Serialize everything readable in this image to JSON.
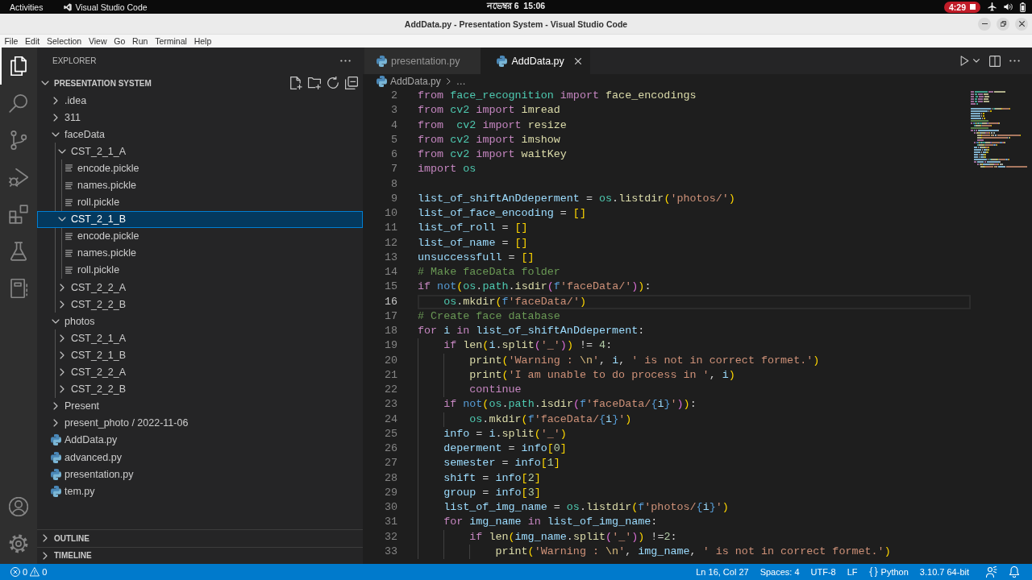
{
  "top_bar": {
    "activities": "Activities",
    "app_name": "Visual Studio Code",
    "clock": "নভেম্বর 6  15:06",
    "recording": "4:29"
  },
  "window": {
    "title": "AddData.py - Presentation System - Visual Studio Code"
  },
  "menu_bar": [
    "File",
    "Edit",
    "Selection",
    "View",
    "Go",
    "Run",
    "Terminal",
    "Help"
  ],
  "activity_bar": {
    "items": [
      {
        "kind": "explorer",
        "selected": true
      },
      {
        "kind": "search",
        "selected": false
      },
      {
        "kind": "scm",
        "selected": false
      },
      {
        "kind": "debug",
        "selected": false
      },
      {
        "kind": "extensions",
        "selected": false
      },
      {
        "kind": "testing",
        "selected": false
      },
      {
        "kind": "notebook",
        "selected": false
      }
    ],
    "bottom_items": [
      {
        "kind": "accounts"
      },
      {
        "kind": "manage"
      }
    ]
  },
  "sidebar": {
    "title": "EXPLORER",
    "workspace": {
      "title": "PRESENTATION SYSTEM",
      "expanded": true
    },
    "tree": [
      {
        "label": ".idea",
        "kind": "folder",
        "expanded": false,
        "selected": false
      },
      {
        "label": "311",
        "kind": "folder",
        "expanded": false,
        "selected": false
      },
      {
        "label": "faceData",
        "kind": "folder",
        "expanded": true,
        "selected": false,
        "children": [
          {
            "label": "CST_2_1_A",
            "kind": "folder",
            "expanded": true,
            "selected": false,
            "children": [
              {
                "label": "encode.pickle",
                "kind": "data",
                "selected": false
              },
              {
                "label": "names.pickle",
                "kind": "data",
                "selected": false
              },
              {
                "label": "roll.pickle",
                "kind": "data",
                "selected": false
              }
            ]
          },
          {
            "label": "CST_2_1_B",
            "kind": "folder",
            "expanded": true,
            "selected": true,
            "children": [
              {
                "label": "encode.pickle",
                "kind": "data",
                "selected": false
              },
              {
                "label": "names.pickle",
                "kind": "data",
                "selected": false
              },
              {
                "label": "roll.pickle",
                "kind": "data",
                "selected": false
              }
            ]
          },
          {
            "label": "CST_2_2_A",
            "kind": "folder",
            "expanded": false,
            "selected": false
          },
          {
            "label": "CST_2_2_B",
            "kind": "folder",
            "expanded": false,
            "selected": false
          }
        ]
      },
      {
        "label": "photos",
        "kind": "folder",
        "expanded": true,
        "selected": false,
        "children": [
          {
            "label": "CST_2_1_A",
            "kind": "folder",
            "expanded": false,
            "selected": false
          },
          {
            "label": "CST_2_1_B",
            "kind": "folder",
            "expanded": false,
            "selected": false
          },
          {
            "label": "CST_2_2_A",
            "kind": "folder",
            "expanded": false,
            "selected": false
          },
          {
            "label": "CST_2_2_B",
            "kind": "folder",
            "expanded": false,
            "selected": false
          }
        ]
      },
      {
        "label": "Present",
        "kind": "folder",
        "expanded": false,
        "selected": false
      },
      {
        "label": "present_photo / 2022-11-06",
        "kind": "folder",
        "expanded": false,
        "selected": false
      },
      {
        "label": "AddData.py",
        "kind": "python",
        "selected": false
      },
      {
        "label": "advanced.py",
        "kind": "python",
        "selected": false
      },
      {
        "label": "presentation.py",
        "kind": "python",
        "selected": false
      },
      {
        "label": "tem.py",
        "kind": "python",
        "selected": false
      }
    ],
    "sections": [
      {
        "title": "OUTLINE",
        "expanded": false
      },
      {
        "title": "TIMELINE",
        "expanded": false
      }
    ]
  },
  "editor": {
    "tabs": [
      {
        "label": "presentation.py",
        "selected": false
      },
      {
        "label": "AddData.py",
        "selected": true
      }
    ],
    "breadcrumb": {
      "file": "AddData.py",
      "trail": "…"
    },
    "lines": [
      {
        "number": "2",
        "current": false,
        "tokens": [
          {
            "text": "from ",
            "kind": "keyword"
          },
          {
            "text": "face_recognition ",
            "kind": "module"
          },
          {
            "text": "import ",
            "kind": "keyword"
          },
          {
            "text": "face_encodings",
            "kind": "function"
          }
        ]
      },
      {
        "number": "3",
        "current": false,
        "tokens": [
          {
            "text": "from ",
            "kind": "keyword"
          },
          {
            "text": "cv2 ",
            "kind": "module"
          },
          {
            "text": "import ",
            "kind": "keyword"
          },
          {
            "text": "imread",
            "kind": "function"
          }
        ]
      },
      {
        "number": "4",
        "current": false,
        "tokens": [
          {
            "text": "from  ",
            "kind": "keyword"
          },
          {
            "text": "cv2 ",
            "kind": "module"
          },
          {
            "text": "import ",
            "kind": "keyword"
          },
          {
            "text": "resize",
            "kind": "function"
          }
        ]
      },
      {
        "number": "5",
        "current": false,
        "tokens": [
          {
            "text": "from ",
            "kind": "keyword"
          },
          {
            "text": "cv2 ",
            "kind": "module"
          },
          {
            "text": "import ",
            "kind": "keyword"
          },
          {
            "text": "imshow",
            "kind": "function"
          }
        ]
      },
      {
        "number": "6",
        "current": false,
        "tokens": [
          {
            "text": "from ",
            "kind": "keyword"
          },
          {
            "text": "cv2 ",
            "kind": "module"
          },
          {
            "text": "import ",
            "kind": "keyword"
          },
          {
            "text": "waitKey",
            "kind": "function"
          }
        ]
      },
      {
        "number": "7",
        "current": false,
        "tokens": [
          {
            "text": "import ",
            "kind": "keyword"
          },
          {
            "text": "os",
            "kind": "module"
          }
        ]
      },
      {
        "number": "8",
        "current": false
      },
      {
        "number": "9",
        "current": false,
        "tokens": [
          {
            "text": "list_of_shiftAnDdeperment",
            "kind": "variable"
          },
          {
            "text": " = ",
            "kind": "plain"
          },
          {
            "text": "os",
            "kind": "module"
          },
          {
            "text": ".",
            "kind": "plain"
          },
          {
            "text": "listdir",
            "kind": "function"
          },
          {
            "text": "(",
            "kind": "bracket1"
          },
          {
            "text": "'photos/'",
            "kind": "string"
          },
          {
            "text": ")",
            "kind": "bracket1"
          }
        ]
      },
      {
        "number": "10",
        "current": false,
        "tokens": [
          {
            "text": "list_of_face_encoding",
            "kind": "variable"
          },
          {
            "text": " = ",
            "kind": "plain"
          },
          {
            "text": "[]",
            "kind": "bracket1"
          }
        ]
      },
      {
        "number": "11",
        "current": false,
        "tokens": [
          {
            "text": "list_of_roll",
            "kind": "variable"
          },
          {
            "text": " = ",
            "kind": "plain"
          },
          {
            "text": "[]",
            "kind": "bracket1"
          }
        ]
      },
      {
        "number": "12",
        "current": false,
        "tokens": [
          {
            "text": "list_of_name",
            "kind": "variable"
          },
          {
            "text": " = ",
            "kind": "plain"
          },
          {
            "text": "[]",
            "kind": "bracket1"
          }
        ]
      },
      {
        "number": "13",
        "current": false,
        "tokens": [
          {
            "text": "unsuccessfull",
            "kind": "variable"
          },
          {
            "text": " = ",
            "kind": "plain"
          },
          {
            "text": "[]",
            "kind": "bracket1"
          }
        ]
      },
      {
        "number": "14",
        "current": false,
        "tokens": [
          {
            "text": "# Make faceData folder",
            "kind": "comment"
          }
        ]
      },
      {
        "number": "15",
        "current": false,
        "tokens": [
          {
            "text": "if ",
            "kind": "keyword"
          },
          {
            "text": "not",
            "kind": "operator"
          },
          {
            "text": "(",
            "kind": "bracket1"
          },
          {
            "text": "os",
            "kind": "module"
          },
          {
            "text": ".",
            "kind": "plain"
          },
          {
            "text": "path",
            "kind": "module"
          },
          {
            "text": ".",
            "kind": "plain"
          },
          {
            "text": "isdir",
            "kind": "function"
          },
          {
            "text": "(",
            "kind": "bracket2"
          },
          {
            "text": "f",
            "kind": "operator"
          },
          {
            "text": "'faceData/'",
            "kind": "string"
          },
          {
            "text": ")",
            "kind": "bracket2"
          },
          {
            "text": ")",
            "kind": "bracket1"
          },
          {
            "text": ":",
            "kind": "plain"
          }
        ]
      },
      {
        "number": "16",
        "current": true,
        "tokens": [
          {
            "text": "    os",
            "kind": "module"
          },
          {
            "text": ".",
            "kind": "plain"
          },
          {
            "text": "mkdir",
            "kind": "function"
          },
          {
            "text": "(",
            "kind": "bracket1"
          },
          {
            "text": "f",
            "kind": "operator"
          },
          {
            "text": "'faceData/'",
            "kind": "string"
          },
          {
            "text": ")",
            "kind": "bracket1"
          }
        ]
      },
      {
        "number": "17",
        "current": false,
        "tokens": [
          {
            "text": "# Create face database",
            "kind": "comment"
          }
        ]
      },
      {
        "number": "18",
        "current": false,
        "tokens": [
          {
            "text": "for ",
            "kind": "keyword"
          },
          {
            "text": "i",
            "kind": "variable"
          },
          {
            "text": " in ",
            "kind": "keyword"
          },
          {
            "text": "list_of_shiftAnDdeperment",
            "kind": "variable"
          },
          {
            "text": ":",
            "kind": "plain"
          }
        ]
      },
      {
        "number": "19",
        "current": false,
        "tokens": [
          {
            "text": "    if ",
            "kind": "keyword"
          },
          {
            "text": "len",
            "kind": "function"
          },
          {
            "text": "(",
            "kind": "bracket1"
          },
          {
            "text": "i",
            "kind": "variable"
          },
          {
            "text": ".",
            "kind": "plain"
          },
          {
            "text": "split",
            "kind": "function"
          },
          {
            "text": "(",
            "kind": "bracket2"
          },
          {
            "text": "'_'",
            "kind": "string"
          },
          {
            "text": ")",
            "kind": "bracket2"
          },
          {
            "text": ")",
            "kind": "bracket1"
          },
          {
            "text": " != ",
            "kind": "plain"
          },
          {
            "text": "4",
            "kind": "number"
          },
          {
            "text": ":",
            "kind": "plain"
          }
        ]
      },
      {
        "number": "20",
        "current": false,
        "tokens": [
          {
            "text": "        print",
            "kind": "function"
          },
          {
            "text": "(",
            "kind": "bracket1"
          },
          {
            "text": "'Warning : ",
            "kind": "string"
          },
          {
            "text": "\\n",
            "kind": "escape"
          },
          {
            "text": "'",
            "kind": "string"
          },
          {
            "text": ", ",
            "kind": "plain"
          },
          {
            "text": "i",
            "kind": "variable"
          },
          {
            "text": ", ",
            "kind": "plain"
          },
          {
            "text": "' is not in correct formet.'",
            "kind": "string"
          },
          {
            "text": ")",
            "kind": "bracket1"
          }
        ]
      },
      {
        "number": "21",
        "current": false,
        "tokens": [
          {
            "text": "        print",
            "kind": "function"
          },
          {
            "text": "(",
            "kind": "bracket1"
          },
          {
            "text": "'I am unable to do process in '",
            "kind": "string"
          },
          {
            "text": ", ",
            "kind": "plain"
          },
          {
            "text": "i",
            "kind": "variable"
          },
          {
            "text": ")",
            "kind": "bracket1"
          }
        ]
      },
      {
        "number": "22",
        "current": false,
        "tokens": [
          {
            "text": "        continue",
            "kind": "keyword"
          }
        ]
      },
      {
        "number": "23",
        "current": false,
        "tokens": [
          {
            "text": "    if ",
            "kind": "keyword"
          },
          {
            "text": "not",
            "kind": "operator"
          },
          {
            "text": "(",
            "kind": "bracket1"
          },
          {
            "text": "os",
            "kind": "module"
          },
          {
            "text": ".",
            "kind": "plain"
          },
          {
            "text": "path",
            "kind": "module"
          },
          {
            "text": ".",
            "kind": "plain"
          },
          {
            "text": "isdir",
            "kind": "function"
          },
          {
            "text": "(",
            "kind": "bracket2"
          },
          {
            "text": "f",
            "kind": "operator"
          },
          {
            "text": "'faceData/",
            "kind": "string"
          },
          {
            "text": "{",
            "kind": "operator"
          },
          {
            "text": "i",
            "kind": "variable"
          },
          {
            "text": "}",
            "kind": "operator"
          },
          {
            "text": "'",
            "kind": "string"
          },
          {
            "text": ")",
            "kind": "bracket2"
          },
          {
            "text": ")",
            "kind": "bracket1"
          },
          {
            "text": ":",
            "kind": "plain"
          }
        ]
      },
      {
        "number": "24",
        "current": false,
        "tokens": [
          {
            "text": "        os",
            "kind": "module"
          },
          {
            "text": ".",
            "kind": "plain"
          },
          {
            "text": "mkdir",
            "kind": "function"
          },
          {
            "text": "(",
            "kind": "bracket1"
          },
          {
            "text": "f",
            "kind": "operator"
          },
          {
            "text": "'faceData/",
            "kind": "string"
          },
          {
            "text": "{",
            "kind": "operator"
          },
          {
            "text": "i",
            "kind": "variable"
          },
          {
            "text": "}",
            "kind": "operator"
          },
          {
            "text": "'",
            "kind": "string"
          },
          {
            "text": ")",
            "kind": "bracket1"
          }
        ]
      },
      {
        "number": "25",
        "current": false,
        "tokens": [
          {
            "text": "    info",
            "kind": "variable"
          },
          {
            "text": " = ",
            "kind": "plain"
          },
          {
            "text": "i",
            "kind": "variable"
          },
          {
            "text": ".",
            "kind": "plain"
          },
          {
            "text": "split",
            "kind": "function"
          },
          {
            "text": "(",
            "kind": "bracket1"
          },
          {
            "text": "'_'",
            "kind": "string"
          },
          {
            "text": ")",
            "kind": "bracket1"
          }
        ]
      },
      {
        "number": "26",
        "current": false,
        "tokens": [
          {
            "text": "    deperment",
            "kind": "variable"
          },
          {
            "text": " = ",
            "kind": "plain"
          },
          {
            "text": "info",
            "kind": "variable"
          },
          {
            "text": "[",
            "kind": "bracket1"
          },
          {
            "text": "0",
            "kind": "number"
          },
          {
            "text": "]",
            "kind": "bracket1"
          }
        ]
      },
      {
        "number": "27",
        "current": false,
        "tokens": [
          {
            "text": "    semester",
            "kind": "variable"
          },
          {
            "text": " = ",
            "kind": "plain"
          },
          {
            "text": "info",
            "kind": "variable"
          },
          {
            "text": "[",
            "kind": "bracket1"
          },
          {
            "text": "1",
            "kind": "number"
          },
          {
            "text": "]",
            "kind": "bracket1"
          }
        ]
      },
      {
        "number": "28",
        "current": false,
        "tokens": [
          {
            "text": "    shift",
            "kind": "variable"
          },
          {
            "text": " = ",
            "kind": "plain"
          },
          {
            "text": "info",
            "kind": "variable"
          },
          {
            "text": "[",
            "kind": "bracket1"
          },
          {
            "text": "2",
            "kind": "number"
          },
          {
            "text": "]",
            "kind": "bracket1"
          }
        ]
      },
      {
        "number": "29",
        "current": false,
        "tokens": [
          {
            "text": "    group",
            "kind": "variable"
          },
          {
            "text": " = ",
            "kind": "plain"
          },
          {
            "text": "info",
            "kind": "variable"
          },
          {
            "text": "[",
            "kind": "bracket1"
          },
          {
            "text": "3",
            "kind": "number"
          },
          {
            "text": "]",
            "kind": "bracket1"
          }
        ]
      },
      {
        "number": "30",
        "current": false,
        "tokens": [
          {
            "text": "    list_of_img_name",
            "kind": "variable"
          },
          {
            "text": " = ",
            "kind": "plain"
          },
          {
            "text": "os",
            "kind": "module"
          },
          {
            "text": ".",
            "kind": "plain"
          },
          {
            "text": "listdir",
            "kind": "function"
          },
          {
            "text": "(",
            "kind": "bracket1"
          },
          {
            "text": "f",
            "kind": "operator"
          },
          {
            "text": "'photos/",
            "kind": "string"
          },
          {
            "text": "{",
            "kind": "operator"
          },
          {
            "text": "i",
            "kind": "variable"
          },
          {
            "text": "}",
            "kind": "operator"
          },
          {
            "text": "'",
            "kind": "string"
          },
          {
            "text": ")",
            "kind": "bracket1"
          }
        ]
      },
      {
        "number": "31",
        "current": false,
        "tokens": [
          {
            "text": "    for ",
            "kind": "keyword"
          },
          {
            "text": "img_name",
            "kind": "variable"
          },
          {
            "text": " in ",
            "kind": "keyword"
          },
          {
            "text": "list_of_img_name",
            "kind": "variable"
          },
          {
            "text": ":",
            "kind": "plain"
          }
        ]
      },
      {
        "number": "32",
        "current": false,
        "tokens": [
          {
            "text": "        if ",
            "kind": "keyword"
          },
          {
            "text": "len",
            "kind": "function"
          },
          {
            "text": "(",
            "kind": "bracket1"
          },
          {
            "text": "img_name",
            "kind": "variable"
          },
          {
            "text": ".",
            "kind": "plain"
          },
          {
            "text": "split",
            "kind": "function"
          },
          {
            "text": "(",
            "kind": "bracket2"
          },
          {
            "text": "'_'",
            "kind": "string"
          },
          {
            "text": ")",
            "kind": "bracket2"
          },
          {
            "text": ")",
            "kind": "bracket1"
          },
          {
            "text": " !=",
            "kind": "plain"
          },
          {
            "text": "2",
            "kind": "number"
          },
          {
            "text": ":",
            "kind": "plain"
          }
        ]
      },
      {
        "number": "33",
        "current": false,
        "tokens": [
          {
            "text": "            print",
            "kind": "function"
          },
          {
            "text": "(",
            "kind": "bracket1"
          },
          {
            "text": "'Warning : ",
            "kind": "string"
          },
          {
            "text": "\\n",
            "kind": "escape"
          },
          {
            "text": "'",
            "kind": "string"
          },
          {
            "text": ", ",
            "kind": "plain"
          },
          {
            "text": "img_name",
            "kind": "variable"
          },
          {
            "text": ", ",
            "kind": "plain"
          },
          {
            "text": "' is not in correct formet.'",
            "kind": "string"
          },
          {
            "text": ")",
            "kind": "bracket1"
          }
        ]
      }
    ]
  },
  "status_bar": {
    "problems": {
      "errors": "0",
      "warnings": "0"
    },
    "items": [
      {
        "text": "Ln 16, Col 27",
        "kind": "text"
      },
      {
        "text": "Spaces: 4",
        "kind": "text"
      },
      {
        "text": "UTF-8",
        "kind": "text"
      },
      {
        "text": "LF",
        "kind": "text"
      },
      {
        "text": "Python",
        "kind": "language"
      },
      {
        "text": "3.10.7 64-bit",
        "kind": "text"
      }
    ]
  }
}
